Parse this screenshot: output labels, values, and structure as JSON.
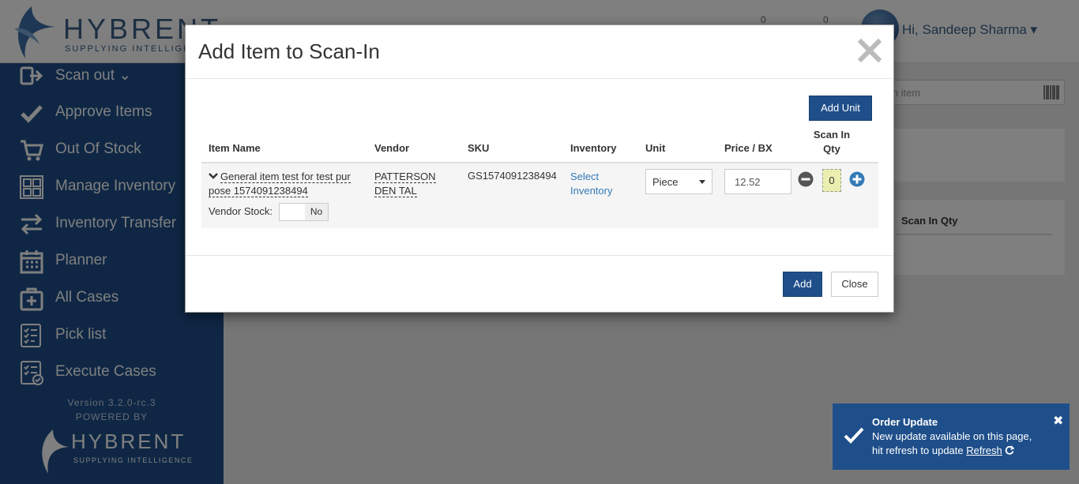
{
  "header": {
    "logo_word": "HYBRENT",
    "logo_tag": "SUPPLYING INTELLIGENCE",
    "count_1": "0",
    "count_2": "0",
    "greeting": "Hi, Sandeep Sharma"
  },
  "sidebar": {
    "items": [
      {
        "label": "Scan out",
        "icon": "sign-out-icon"
      },
      {
        "label": "Approve Items",
        "icon": "check-icon"
      },
      {
        "label": "Out Of Stock",
        "icon": "cart-icon"
      },
      {
        "label": "Manage Inventory",
        "icon": "inventory-icon"
      },
      {
        "label": "Inventory Transfer",
        "icon": "transfer-icon"
      },
      {
        "label": "Planner",
        "icon": "calendar-icon"
      },
      {
        "label": "All Cases",
        "icon": "medical-case-icon"
      },
      {
        "label": "Pick list",
        "icon": "checklist-icon"
      },
      {
        "label": "Execute Cases",
        "icon": "checklist-check-icon"
      }
    ],
    "version": "Version 3.2.0-rc.3",
    "powered_by": "POWERED BY",
    "footer_logo_word": "HYBRENT",
    "footer_logo_tag": "SUPPLYING INTELLIGENCE"
  },
  "background": {
    "search_placeholder": "rch item",
    "panel_heading": "Scan In Qty"
  },
  "modal": {
    "title": "Add Item to Scan-In",
    "add_unit_label": "Add Unit",
    "columns": {
      "item_name": "Item Name",
      "vendor": "Vendor",
      "sku": "SKU",
      "inventory": "Inventory",
      "unit": "Unit",
      "price": "Price / BX",
      "scan_in_qty_line1": "Scan In",
      "scan_in_qty_line2": "Qty"
    },
    "row": {
      "item_name": "General item test for test pur pose 1574091238494",
      "vendor": "PATTERSON DEN TAL",
      "sku": "GS1574091238494",
      "inventory_link": "Select Inventory",
      "unit": "Piece",
      "price": "12.52",
      "qty": "0",
      "vendor_stock_label": "Vendor Stock:",
      "vendor_stock_value": "No"
    },
    "add_button": "Add",
    "close_button": "Close"
  },
  "toast": {
    "title": "Order Update",
    "line1": "New update available on this page,",
    "line2_prefix": "hit refresh to update ",
    "link": "Refresh"
  },
  "colors": {
    "brand": "#1f4f8a",
    "link": "#337ab7",
    "qty_bg": "#ebeeb0"
  }
}
